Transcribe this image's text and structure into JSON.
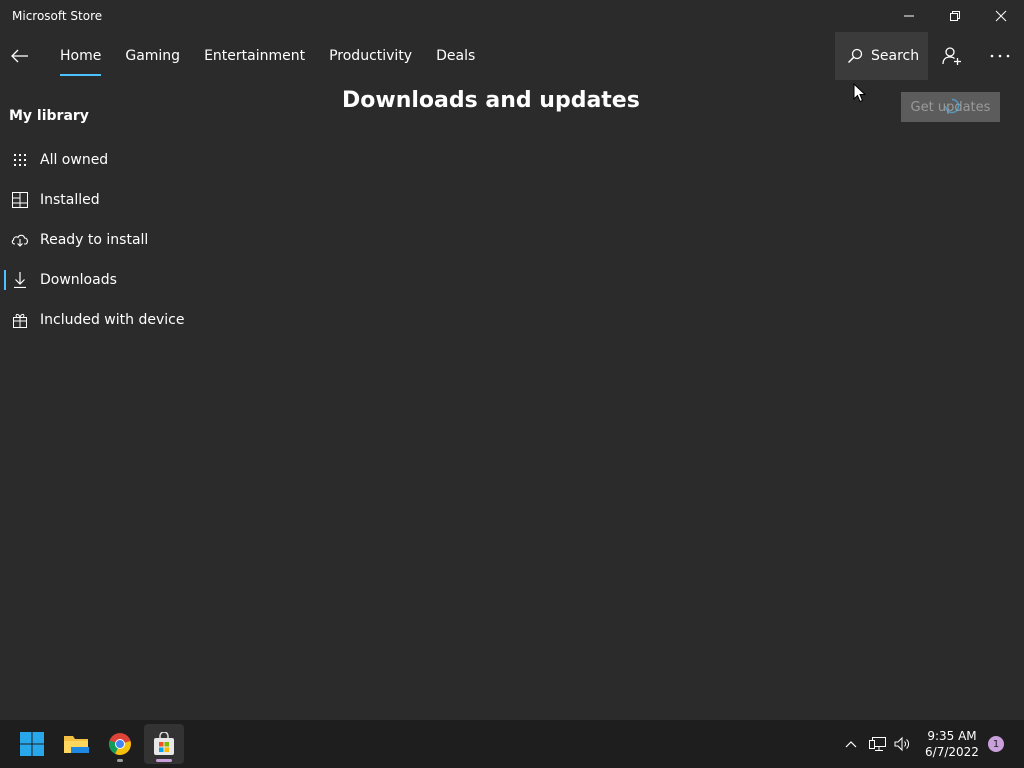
{
  "window": {
    "title": "Microsoft Store",
    "controls": {
      "minimize_icon": "minimize-icon",
      "restore_icon": "restore-icon",
      "close_icon": "close-icon"
    }
  },
  "nav": {
    "back_icon": "back-arrow-icon",
    "tabs": [
      {
        "label": "Home",
        "active": true
      },
      {
        "label": "Gaming",
        "active": false
      },
      {
        "label": "Entertainment",
        "active": false
      },
      {
        "label": "Productivity",
        "active": false
      },
      {
        "label": "Deals",
        "active": false
      }
    ],
    "search_label": "Search",
    "search_icon": "search-icon",
    "account_icon": "add-account-icon",
    "more_icon": "more-icon"
  },
  "sidebar": {
    "title": "My library",
    "items": [
      {
        "label": "All owned",
        "icon": "grid-icon",
        "selected": false
      },
      {
        "label": "Installed",
        "icon": "installed-icon",
        "selected": false
      },
      {
        "label": "Ready to install",
        "icon": "cloud-download-icon",
        "selected": false
      },
      {
        "label": "Downloads",
        "icon": "download-icon",
        "selected": true
      },
      {
        "label": "Included with device",
        "icon": "gift-icon",
        "selected": false
      }
    ]
  },
  "main": {
    "title": "Downloads and updates",
    "get_updates_label": "Get updates"
  },
  "taskbar": {
    "apps": [
      {
        "name": "windows-start",
        "icon": "windows-logo-icon"
      },
      {
        "name": "file-explorer",
        "icon": "folder-icon"
      },
      {
        "name": "chrome",
        "icon": "chrome-icon"
      },
      {
        "name": "microsoft-store",
        "icon": "store-icon",
        "active": true
      }
    ],
    "tray": {
      "chevron_icon": "chevron-up-icon",
      "network_icon": "network-icon",
      "volume_icon": "volume-icon"
    },
    "time": "9:35 AM",
    "date": "6/7/2022",
    "notification_count": "1"
  },
  "colors": {
    "background": "#2b2b2b",
    "accent": "#4cc2ff",
    "taskbar": "#1e1e1e",
    "button_disabled": "#5c5c5c"
  }
}
